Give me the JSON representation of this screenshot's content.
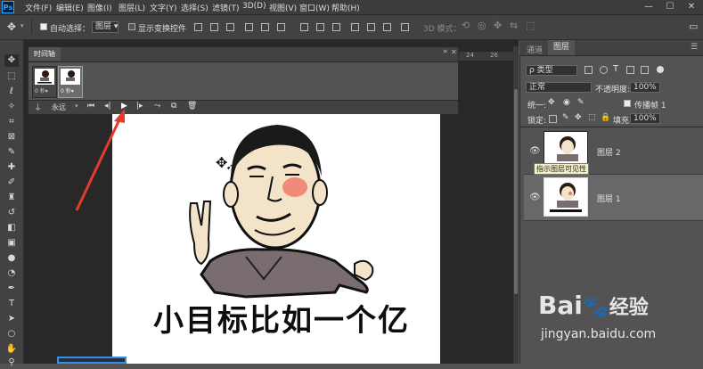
{
  "app": {
    "logo": "Ps"
  },
  "menu": [
    "文件(F)",
    "编辑(E)",
    "图像(I)",
    "图层(L)",
    "文字(Y)",
    "选择(S)",
    "滤镜(T)",
    "3D(D)",
    "视图(V)",
    "窗口(W)",
    "帮助(H)"
  ],
  "window_controls": {
    "minimize": "—",
    "maximize": "☐",
    "close": "✕"
  },
  "options": {
    "auto_select_label": "自动选择：",
    "auto_select_value": "图层",
    "transform_label": "显示变换控件",
    "mode_3d": "3D 模式："
  },
  "timeline": {
    "title": "时间轴",
    "loop_value": "永远",
    "frame1_time": "0 秒▾",
    "frame2_time": "0 秒▾",
    "ruler": [
      "24",
      "26"
    ]
  },
  "canvas": {
    "caption": "小目标比如一个亿"
  },
  "panel": {
    "tabs": [
      "通道",
      "图层"
    ],
    "filter_label": "ρ 类型",
    "blend_mode": "正常",
    "opacity_label": "不透明度:",
    "opacity_value": "100%",
    "unify_label": "统一:",
    "propagate_label": "传播帧 1",
    "lock_label": "锁定:",
    "fill_label": "填充:",
    "fill_value": "100%",
    "layers": [
      {
        "name": "图层 2"
      },
      {
        "name": "图层 1"
      }
    ],
    "tooltip": "指示图层可见性"
  },
  "watermark": {
    "logo": "Bai",
    "logo2": "经验",
    "url": "jingyan.baidu.com"
  },
  "colors": {
    "accent_arrow": "#e53b2c",
    "panel_bg": "#535353",
    "dark_bg": "#282828",
    "selected_row": "#686868"
  }
}
